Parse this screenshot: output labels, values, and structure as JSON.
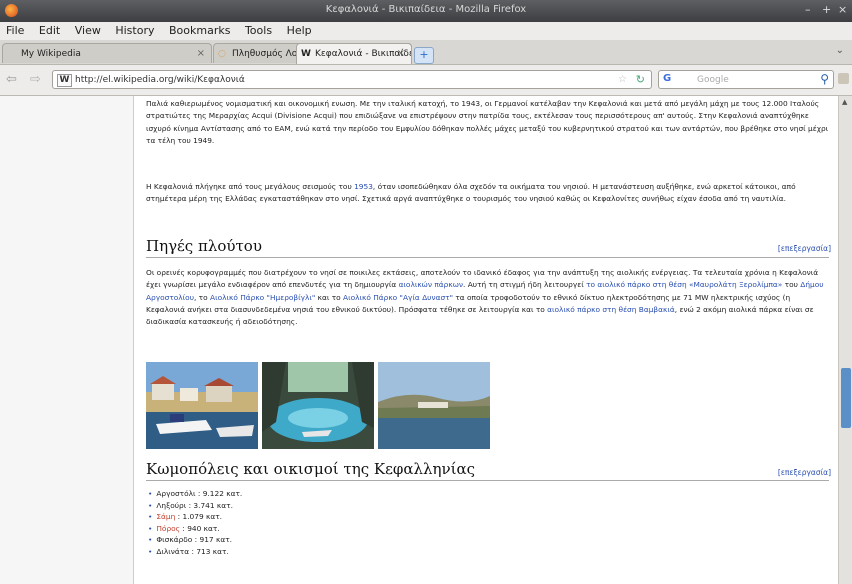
{
  "window": {
    "title": "Κεφαλονιά - Βικιπαίδεια - Mozilla Firefox",
    "controls": [
      "–",
      "+",
      "×"
    ]
  },
  "menu": [
    "File",
    "Edit",
    "View",
    "History",
    "Bookmarks",
    "Tools",
    "Help"
  ],
  "tabs": [
    {
      "label": "My Wikipedia",
      "favicon": "",
      "active": false
    },
    {
      "label": "Πληθυσμός Λογισμού / Λογισμού",
      "favicon": "◌",
      "active": false
    },
    {
      "label": "Κεφαλονιά - Βικιπαίδεια",
      "favicon": "W",
      "active": true
    }
  ],
  "new_tab": "+",
  "url": "http://el.wikipedia.org/wiki/Κεφαλονιά",
  "search": {
    "engine": "G",
    "placeholder": "Google"
  },
  "article": {
    "p1": "Παλιά καθιερωμένος νομισματική και οικονομική ενωση. Με την ιταλική κατοχή, το 1943, οι Γερμανοί κατέλαβαν την Κεφαλονιά και μετά από μεγάλη μάχη με τους 12.000 Ιταλούς στρατιώτες της Μεραρχίας Acqui (Divisione Acqui) που επιδιώξανε να επιστρέψουν στην πατρίδα τους, εκτέλεσαν τους περισσότερους απ' αυτούς. Στην Κεφαλονιά αναπτύχθηκε ισχυρό κίνημα Αντίστασης από το ΕΑΜ, ενώ κατά την περίοδο του Εμφυλίου δόθηκαν πολλές μάχες μεταξύ του κυβερνητικού στρατού και των αντάρτών, που βρέθηκε στο νησί μέχρι τα τέλη του 1949.",
    "p2_a": "Η Κεφαλονιά πλήγηκε από τους μεγάλους σεισμούς του ",
    "p2_link": "1953",
    "p2_b": ", όταν ισοπεδώθηκαν όλα σχεδόν τα οικήματα του νησιού. Η μετανάστευση αυξήθηκε, ενώ αρκετοί κάτοικοι, από στημέτερα μέρη της Ελλάδας εγκαταστάθηκαν στο νησί. Σχετικά αργά αναπτύχθηκε ο τουρισμός του νησιού καθώς οι Κεφαλονίτες συνήθως είχαν έσοδα από τη ναυτιλία.",
    "h1": "Πηγές πλούτου",
    "edit": "[επεξεργασία]",
    "p3_a": "Οι ορεινές κορυφογραμμές που διατρέχουν το νησί σε ποικιλες εκτάσεις, αποτελούν το ιδανικό έδαφος για την ανάπτυξη της αιολικής ενέργειας. Τα τελευταία χρόνια η Κεφαλονιά έχει γνωρίσει μεγάλο ενδιαφέρον από επενδυτές για τη δημιουργία ",
    "p3_l1": "αιολικών πάρκων",
    "p3_b": ". Αυτή τη στιγμή ήδη λειτουργεί ",
    "p3_l2": "το αιολικό πάρκο στη θέση «Μαυρολάτη Ξερολίμπα»",
    "p3_c": " του ",
    "p3_l3": "Δήμου Αργοστολίου",
    "p3_d": ", το ",
    "p3_l4": "Αιολικό Πάρκο \"Ημεροβίγλι\"",
    "p3_e": " και το ",
    "p3_l5": "Αιολικό Πάρκο \"Αγία Δυναστ\"",
    "p3_f": " τα οποία τροφοδοτούν το εθνικό δίκτυο ηλεκτροδότησης με 71 MW ηλεκτρικής ισχύος (η Κεφαλονιά ανήκει στα διασυνδεδεμένα νησιά του εθνικού δικτύου). Πρόσφατα τέθηκε σε λειτουργία και το ",
    "p3_l6": "αιολικό πάρκο στη θέση Βαμβακιά",
    "p3_g": ", ενώ 2 ακόμη αιολικά πάρκα είναι σε διαδικασία κατασκευής ή αδειοδότησης.",
    "h2": "Κωμοπόλεις και οικισμοί της Κεφαλληνίας",
    "towns": [
      {
        "name": "Αργοστόλι",
        "pop": " : 9.122 κατ.",
        "color": "link"
      },
      {
        "name": "Ληξούρι",
        "pop": " : 3.741 κατ.",
        "color": "link"
      },
      {
        "name": "Σάμη",
        "pop": " : 1.079 κατ.",
        "color": "red"
      },
      {
        "name": "Πόρος",
        "pop": " : 940 κατ.",
        "color": "red"
      },
      {
        "name": "Φισκάρδο",
        "pop": " : 917 κατ.",
        "color": "plain"
      },
      {
        "name": "Διλινάτα",
        "pop": " : 713 κατ.",
        "color": "plain"
      }
    ]
  },
  "colors": {
    "link": "#2a4fb0",
    "redlink": "#c3412f",
    "scroll_thumb": "#5a8fc8"
  }
}
